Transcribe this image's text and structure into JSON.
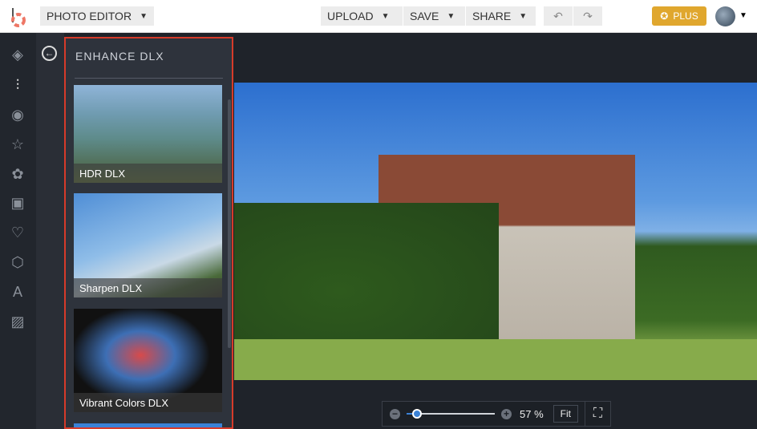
{
  "header": {
    "app_menu": "PHOTO EDITOR",
    "upload": "UPLOAD",
    "save": "SAVE",
    "share": "SHARE",
    "plus": "PLUS"
  },
  "sidebar": {
    "icons": [
      "layers-icon",
      "adjust-sliders-icon",
      "eye-icon",
      "star-icon",
      "badge-icon",
      "frame-icon",
      "heart-icon",
      "shape-icon",
      "text-icon",
      "texture-icon"
    ]
  },
  "panel": {
    "title": "ENHANCE DLX",
    "items": [
      {
        "label": "HDR DLX"
      },
      {
        "label": "Sharpen DLX"
      },
      {
        "label": "Vibrant Colors DLX"
      }
    ]
  },
  "zoom": {
    "value_percent": 57,
    "label": "57 %",
    "fit": "Fit"
  }
}
